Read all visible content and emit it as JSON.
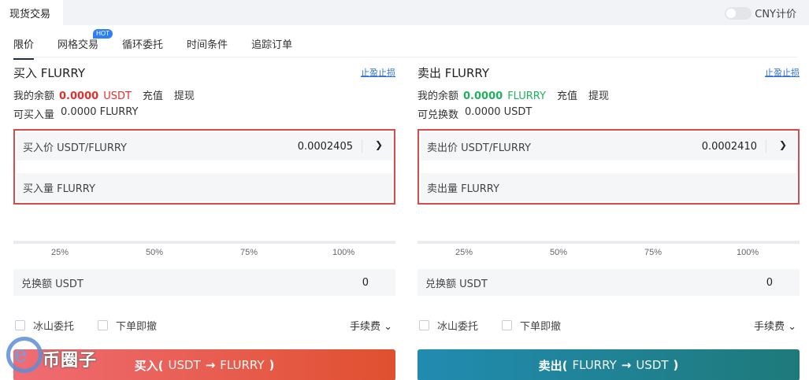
{
  "topbar": {
    "tab_label": "现货交易",
    "cny_label": "CNY计价"
  },
  "subtabs": [
    {
      "label": "限价",
      "active": true
    },
    {
      "label": "网格交易",
      "badge": "HOT"
    },
    {
      "label": "循环委托"
    },
    {
      "label": "时间条件"
    },
    {
      "label": "追踪订单"
    }
  ],
  "buy": {
    "title": "买入 FLURRY",
    "stop_link": "止盈止损",
    "balance_label": "我的余额",
    "balance_value": "0.0000",
    "balance_currency": "USDT",
    "deposit": "充值",
    "withdraw": "提现",
    "avail_label": "可买入量",
    "avail_value": "0.0000 FLURRY",
    "price_label": "买入价 USDT/FLURRY",
    "price_value": "0.0002405",
    "qty_label": "买入量 FLURRY",
    "ticks": [
      "25%",
      "50%",
      "75%",
      "100%"
    ],
    "exchange_label": "兑换额 USDT",
    "exchange_value": "0",
    "iceberg": "冰山委托",
    "ioc": "下单即撤",
    "fee": "手续费",
    "button_main": "买入(",
    "button_from": "USDT",
    "button_arrow": "→",
    "button_to": "FLURRY",
    "button_close": ")"
  },
  "sell": {
    "title": "卖出 FLURRY",
    "stop_link": "止盈止损",
    "balance_label": "我的余额",
    "balance_value": "0.0000",
    "balance_currency": "FLURRY",
    "deposit": "充值",
    "withdraw": "提现",
    "avail_label": "可兑换数",
    "avail_value": "0.0000 USDT",
    "price_label": "卖出价 USDT/FLURRY",
    "price_value": "0.0002410",
    "qty_label": "卖出量 FLURRY",
    "ticks": [
      "25%",
      "50%",
      "75%",
      "100%"
    ],
    "exchange_label": "兑换额 USDT",
    "exchange_value": "0",
    "iceberg": "冰山委托",
    "ioc": "下单即撤",
    "fee": "手续费",
    "button_main": "卖出(",
    "button_from": "FLURRY",
    "button_arrow": "→",
    "button_to": "USDT",
    "button_close": ")"
  },
  "watermark": {
    "text": "币圈子"
  },
  "colors": {
    "buy_accent": "#e0302d",
    "sell_accent": "#1fb15f",
    "highlight_border": "#d94a4a",
    "link": "#2d6fd6"
  }
}
